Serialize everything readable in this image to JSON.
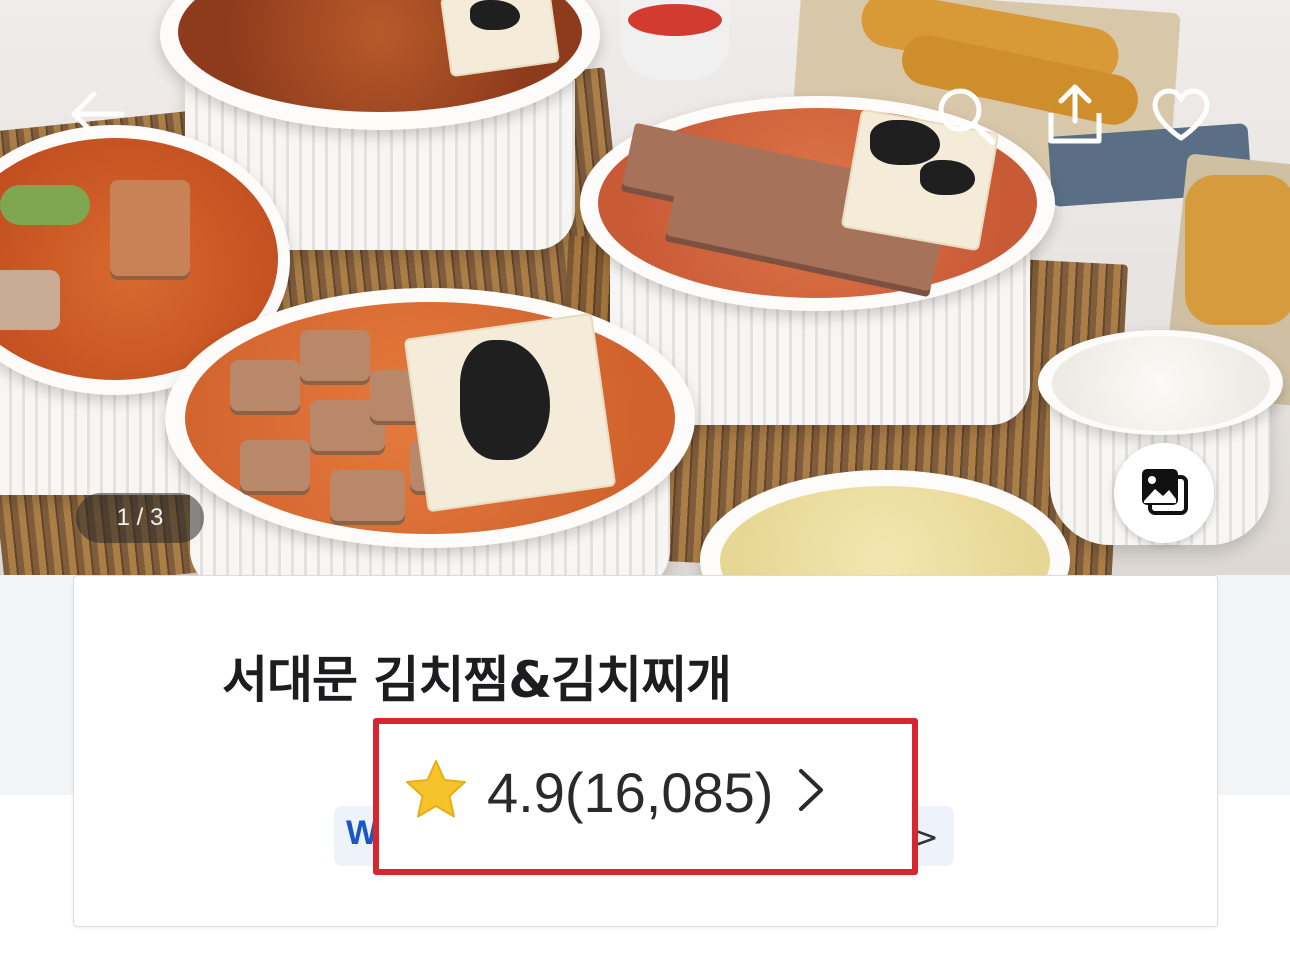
{
  "hero": {
    "page_counter": "1 / 3"
  },
  "icons": {
    "back": "arrow-left-icon",
    "search": "search-icon",
    "share": "share-icon",
    "favorite": "heart-icon",
    "gallery": "image-gallery-icon",
    "rating_star": "star-icon",
    "rating_chevron": "chevron-right-icon"
  },
  "store": {
    "name": "서대문 김치찜&김치찌개",
    "rating": "4.9(16,085)",
    "badge_letter": "W",
    "badge_chevron": ">"
  },
  "colors": {
    "highlight_border": "#d8262e",
    "star": "#f6c32b",
    "badge_text": "#1a56c4"
  }
}
